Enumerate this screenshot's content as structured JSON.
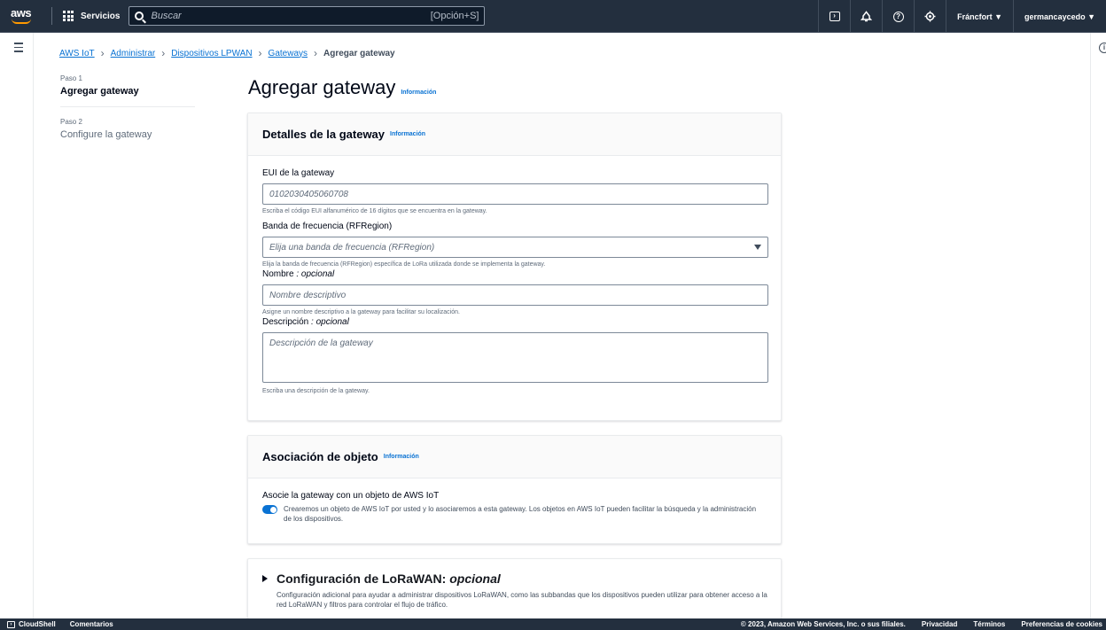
{
  "topnav": {
    "logo": "aws",
    "services": "Servicios",
    "search_placeholder": "Buscar",
    "search_shortcut": "[Opción+S]",
    "region": "Fráncfort ▼",
    "user": "germancaycedo ▼"
  },
  "breadcrumb": [
    "AWS IoT",
    "Administrar",
    "Dispositivos LPWAN",
    "Gateways",
    "Agregar gateway"
  ],
  "steps": [
    {
      "num": "Paso 1",
      "title": "Agregar gateway"
    },
    {
      "num": "Paso 2",
      "title": "Configure la gateway"
    }
  ],
  "page": {
    "title": "Agregar gateway",
    "info": "Información"
  },
  "details": {
    "header": "Detalles de la gateway",
    "info": "Información",
    "eui_label": "EUI de la gateway",
    "eui_placeholder": "0102030405060708",
    "eui_hint": "Escriba el código EUI alfanumérico de 16 dígitos que se encuentra en la gateway.",
    "freq_label": "Banda de frecuencia (RFRegion)",
    "freq_placeholder": "Elija una banda de frecuencia (RFRegion)",
    "freq_hint": "Elija la banda de frecuencia (RFRegion) específica de LoRa utilizada donde se implementa la gateway.",
    "name_label": "Nombre",
    "name_optional": ": opcional",
    "name_placeholder": "Nombre descriptivo",
    "name_hint": "Asigne un nombre descriptivo a la gateway para facilitar su localización.",
    "desc_label": "Descripción",
    "desc_optional": ": opcional",
    "desc_placeholder": "Descripción de la gateway",
    "desc_hint": "Escriba una descripción de la gateway."
  },
  "association": {
    "header": "Asociación de objeto",
    "info": "Información",
    "label": "Asocie la gateway con un objeto de AWS IoT",
    "toggle_on": true,
    "toggle_text": "Crearemos un objeto de AWS IoT por usted y lo asociaremos a esta gateway. Los objetos en AWS IoT pueden facilitar la búsqueda y la administración de los dispositivos."
  },
  "lorawan": {
    "title": "Configuración de LoRaWAN:",
    "optional": "opcional",
    "desc": "Configuración adicional para ayudar a administrar dispositivos LoRaWAN, como las subbandas que los dispositivos pueden utilizar para obtener acceso a la red LoRaWAN y filtros para controlar el flujo de tráfico."
  },
  "footer": {
    "cloudshell": "CloudShell",
    "comments": "Comentarios",
    "copyright": "© 2023, Amazon Web Services, Inc. o sus filiales.",
    "privacy": "Privacidad",
    "terms": "Términos",
    "cookies": "Preferencias de cookies"
  }
}
